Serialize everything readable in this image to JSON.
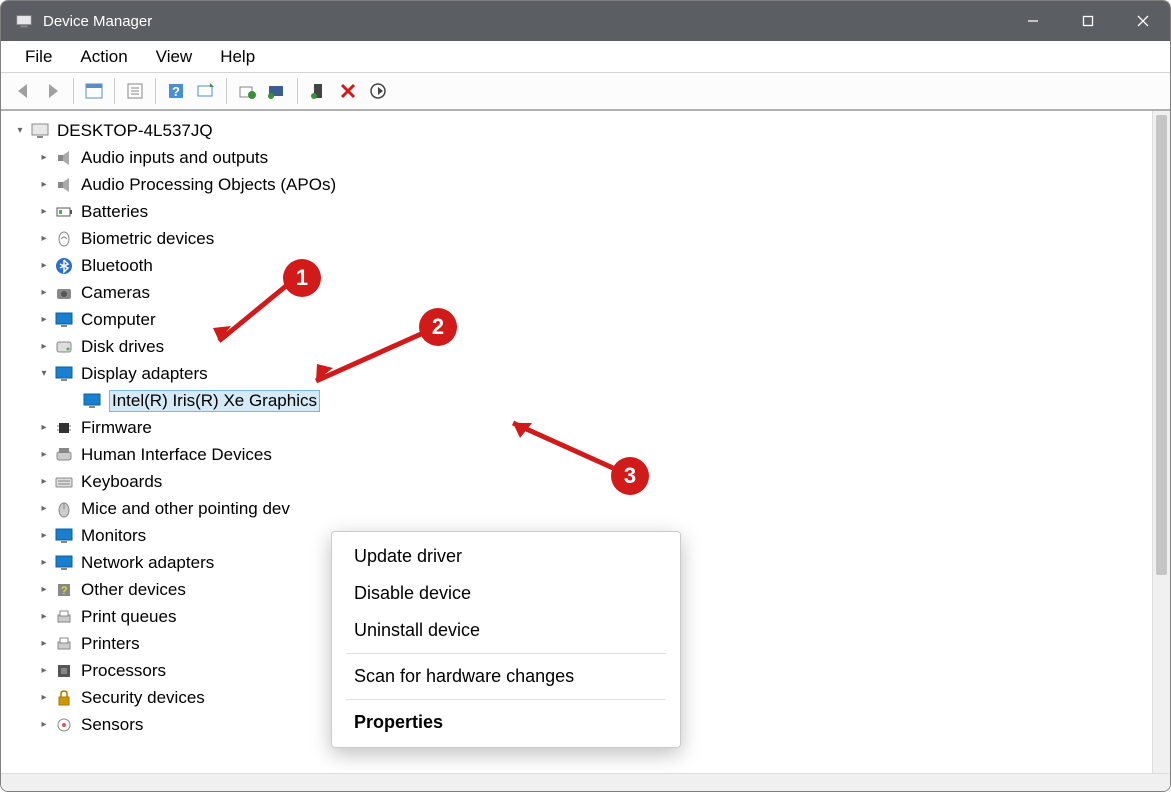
{
  "window": {
    "title": "Device Manager"
  },
  "menu": {
    "items": [
      "File",
      "Action",
      "View",
      "Help"
    ]
  },
  "tree": {
    "root": "DESKTOP-4L537JQ",
    "nodes": [
      {
        "label": "Audio inputs and outputs",
        "icon": "speaker",
        "expanded": false
      },
      {
        "label": "Audio Processing Objects (APOs)",
        "icon": "speaker",
        "expanded": false
      },
      {
        "label": "Batteries",
        "icon": "battery",
        "expanded": false
      },
      {
        "label": "Biometric devices",
        "icon": "finger",
        "expanded": false
      },
      {
        "label": "Bluetooth",
        "icon": "bluetooth",
        "expanded": false
      },
      {
        "label": "Cameras",
        "icon": "camera",
        "expanded": false
      },
      {
        "label": "Computer",
        "icon": "monitor",
        "expanded": false
      },
      {
        "label": "Disk drives",
        "icon": "disk",
        "expanded": false
      },
      {
        "label": "Display adapters",
        "icon": "monitor",
        "expanded": true,
        "children": [
          {
            "label": "Intel(R) Iris(R) Xe Graphics",
            "icon": "monitor",
            "selected": true
          }
        ]
      },
      {
        "label": "Firmware",
        "icon": "chip",
        "expanded": false
      },
      {
        "label": "Human Interface Devices",
        "icon": "hid",
        "expanded": false
      },
      {
        "label": "Keyboards",
        "icon": "keyboard",
        "expanded": false
      },
      {
        "label": "Mice and other pointing dev",
        "icon": "mouse",
        "expanded": false
      },
      {
        "label": "Monitors",
        "icon": "monitor",
        "expanded": false
      },
      {
        "label": "Network adapters",
        "icon": "monitor",
        "expanded": false
      },
      {
        "label": "Other devices",
        "icon": "other",
        "expanded": false
      },
      {
        "label": "Print queues",
        "icon": "printer",
        "expanded": false
      },
      {
        "label": "Printers",
        "icon": "printer",
        "expanded": false
      },
      {
        "label": "Processors",
        "icon": "cpu",
        "expanded": false
      },
      {
        "label": "Security devices",
        "icon": "lock",
        "expanded": false
      },
      {
        "label": "Sensors",
        "icon": "sensor",
        "expanded": false
      }
    ]
  },
  "ctx": {
    "items": [
      "Update driver",
      "Disable device",
      "Uninstall device"
    ],
    "items2": [
      "Scan for hardware changes"
    ],
    "items3": [
      "Properties"
    ]
  },
  "badges": {
    "b1": "1",
    "b2": "2",
    "b3": "3"
  }
}
